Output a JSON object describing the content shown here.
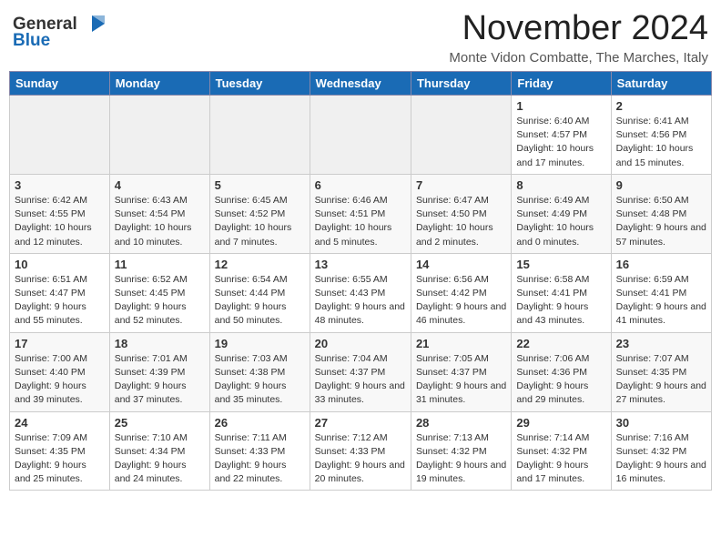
{
  "header": {
    "logo_general": "General",
    "logo_blue": "Blue",
    "month_title": "November 2024",
    "location": "Monte Vidon Combatte, The Marches, Italy"
  },
  "weekdays": [
    "Sunday",
    "Monday",
    "Tuesday",
    "Wednesday",
    "Thursday",
    "Friday",
    "Saturday"
  ],
  "weeks": [
    [
      {
        "day": "",
        "info": ""
      },
      {
        "day": "",
        "info": ""
      },
      {
        "day": "",
        "info": ""
      },
      {
        "day": "",
        "info": ""
      },
      {
        "day": "",
        "info": ""
      },
      {
        "day": "1",
        "info": "Sunrise: 6:40 AM\nSunset: 4:57 PM\nDaylight: 10 hours and 17 minutes."
      },
      {
        "day": "2",
        "info": "Sunrise: 6:41 AM\nSunset: 4:56 PM\nDaylight: 10 hours and 15 minutes."
      }
    ],
    [
      {
        "day": "3",
        "info": "Sunrise: 6:42 AM\nSunset: 4:55 PM\nDaylight: 10 hours and 12 minutes."
      },
      {
        "day": "4",
        "info": "Sunrise: 6:43 AM\nSunset: 4:54 PM\nDaylight: 10 hours and 10 minutes."
      },
      {
        "day": "5",
        "info": "Sunrise: 6:45 AM\nSunset: 4:52 PM\nDaylight: 10 hours and 7 minutes."
      },
      {
        "day": "6",
        "info": "Sunrise: 6:46 AM\nSunset: 4:51 PM\nDaylight: 10 hours and 5 minutes."
      },
      {
        "day": "7",
        "info": "Sunrise: 6:47 AM\nSunset: 4:50 PM\nDaylight: 10 hours and 2 minutes."
      },
      {
        "day": "8",
        "info": "Sunrise: 6:49 AM\nSunset: 4:49 PM\nDaylight: 10 hours and 0 minutes."
      },
      {
        "day": "9",
        "info": "Sunrise: 6:50 AM\nSunset: 4:48 PM\nDaylight: 9 hours and 57 minutes."
      }
    ],
    [
      {
        "day": "10",
        "info": "Sunrise: 6:51 AM\nSunset: 4:47 PM\nDaylight: 9 hours and 55 minutes."
      },
      {
        "day": "11",
        "info": "Sunrise: 6:52 AM\nSunset: 4:45 PM\nDaylight: 9 hours and 52 minutes."
      },
      {
        "day": "12",
        "info": "Sunrise: 6:54 AM\nSunset: 4:44 PM\nDaylight: 9 hours and 50 minutes."
      },
      {
        "day": "13",
        "info": "Sunrise: 6:55 AM\nSunset: 4:43 PM\nDaylight: 9 hours and 48 minutes."
      },
      {
        "day": "14",
        "info": "Sunrise: 6:56 AM\nSunset: 4:42 PM\nDaylight: 9 hours and 46 minutes."
      },
      {
        "day": "15",
        "info": "Sunrise: 6:58 AM\nSunset: 4:41 PM\nDaylight: 9 hours and 43 minutes."
      },
      {
        "day": "16",
        "info": "Sunrise: 6:59 AM\nSunset: 4:41 PM\nDaylight: 9 hours and 41 minutes."
      }
    ],
    [
      {
        "day": "17",
        "info": "Sunrise: 7:00 AM\nSunset: 4:40 PM\nDaylight: 9 hours and 39 minutes."
      },
      {
        "day": "18",
        "info": "Sunrise: 7:01 AM\nSunset: 4:39 PM\nDaylight: 9 hours and 37 minutes."
      },
      {
        "day": "19",
        "info": "Sunrise: 7:03 AM\nSunset: 4:38 PM\nDaylight: 9 hours and 35 minutes."
      },
      {
        "day": "20",
        "info": "Sunrise: 7:04 AM\nSunset: 4:37 PM\nDaylight: 9 hours and 33 minutes."
      },
      {
        "day": "21",
        "info": "Sunrise: 7:05 AM\nSunset: 4:37 PM\nDaylight: 9 hours and 31 minutes."
      },
      {
        "day": "22",
        "info": "Sunrise: 7:06 AM\nSunset: 4:36 PM\nDaylight: 9 hours and 29 minutes."
      },
      {
        "day": "23",
        "info": "Sunrise: 7:07 AM\nSunset: 4:35 PM\nDaylight: 9 hours and 27 minutes."
      }
    ],
    [
      {
        "day": "24",
        "info": "Sunrise: 7:09 AM\nSunset: 4:35 PM\nDaylight: 9 hours and 25 minutes."
      },
      {
        "day": "25",
        "info": "Sunrise: 7:10 AM\nSunset: 4:34 PM\nDaylight: 9 hours and 24 minutes."
      },
      {
        "day": "26",
        "info": "Sunrise: 7:11 AM\nSunset: 4:33 PM\nDaylight: 9 hours and 22 minutes."
      },
      {
        "day": "27",
        "info": "Sunrise: 7:12 AM\nSunset: 4:33 PM\nDaylight: 9 hours and 20 minutes."
      },
      {
        "day": "28",
        "info": "Sunrise: 7:13 AM\nSunset: 4:32 PM\nDaylight: 9 hours and 19 minutes."
      },
      {
        "day": "29",
        "info": "Sunrise: 7:14 AM\nSunset: 4:32 PM\nDaylight: 9 hours and 17 minutes."
      },
      {
        "day": "30",
        "info": "Sunrise: 7:16 AM\nSunset: 4:32 PM\nDaylight: 9 hours and 16 minutes."
      }
    ]
  ]
}
